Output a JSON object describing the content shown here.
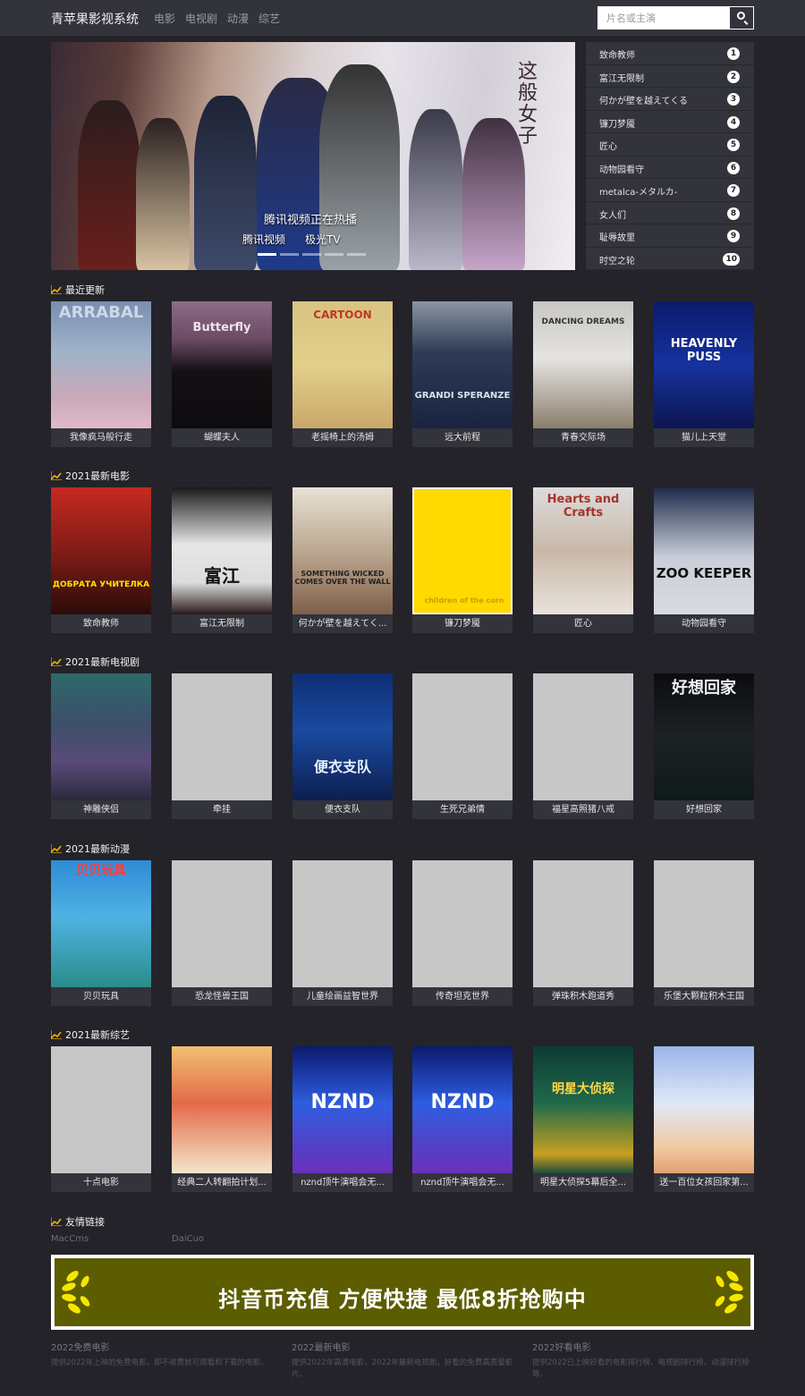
{
  "header": {
    "brand": "青苹果影视系统",
    "nav": [
      "电影",
      "电视剧",
      "动漫",
      "综艺"
    ],
    "search_placeholder": "片名或主演"
  },
  "banner": {
    "vertical_title": "这般女子",
    "caption": "腾讯视频正在热播",
    "logos": [
      "腾讯视频",
      "极光TV"
    ],
    "slide_count": 5,
    "active_slide": 1
  },
  "ranking": [
    {
      "name": "致命教师",
      "num": "1"
    },
    {
      "name": "富江无限制",
      "num": "2"
    },
    {
      "name": "何かが壁を越えてくる",
      "num": "3"
    },
    {
      "name": "镰刀梦魇",
      "num": "4"
    },
    {
      "name": "匠心",
      "num": "5"
    },
    {
      "name": "动物园看守",
      "num": "6"
    },
    {
      "name": "metalca-メタルカ-",
      "num": "7"
    },
    {
      "name": "女人们",
      "num": "8"
    },
    {
      "name": "耻辱故里",
      "num": "9"
    },
    {
      "name": "时空之轮",
      "num": "10"
    }
  ],
  "sections": [
    {
      "title": "最近更新",
      "items": [
        {
          "caption": "我像疯马般行走",
          "poster_text": "ARRABAL",
          "style": "arrabal"
        },
        {
          "caption": "蝴蝶夫人",
          "poster_text": "Butterfly",
          "style": "butterfly"
        },
        {
          "caption": "老摇椅上的汤姆",
          "poster_text": "CARTOON",
          "style": "cartoon"
        },
        {
          "caption": "远大前程",
          "poster_text": "GRANDI SPERANZE",
          "style": "grandi"
        },
        {
          "caption": "青春交际场",
          "poster_text": "DANCING DREAMS",
          "style": "dancing"
        },
        {
          "caption": "猫儿上天堂",
          "poster_text": "HEAVENLY PUSS",
          "style": "heavenly"
        }
      ]
    },
    {
      "title": "2021最新电影",
      "items": [
        {
          "caption": "致命教师",
          "poster_text": "ДОБРАТА УЧИТЕЛКА",
          "style": "uchitelka"
        },
        {
          "caption": "富江无限制",
          "poster_text": "富江",
          "style": "tomie"
        },
        {
          "caption": "何かが壁を越えてく...",
          "poster_text": "SOMETHING WICKED COMES OVER THE WALL",
          "style": "wall"
        },
        {
          "caption": "镰刀梦魇",
          "poster_text": "children of the corn",
          "style": "corn"
        },
        {
          "caption": "匠心",
          "poster_text": "Hearts and Crafts",
          "style": "hearts"
        },
        {
          "caption": "动物园看守",
          "poster_text": "ZOO KEEPER",
          "style": "zoo"
        }
      ]
    },
    {
      "title": "2021最新电视剧",
      "items": [
        {
          "caption": "神雕侠侣",
          "poster_text": "",
          "style": "shendiao"
        },
        {
          "caption": "牵挂",
          "poster_text": "",
          "style": "empty"
        },
        {
          "caption": "便衣支队",
          "poster_text": "便衣支队",
          "style": "bianyi"
        },
        {
          "caption": "生死兄弟情",
          "poster_text": "",
          "style": "empty"
        },
        {
          "caption": "福星高照猪八戒",
          "poster_text": "",
          "style": "empty"
        },
        {
          "caption": "好想回家",
          "poster_text": "好想回家",
          "style": "haoxiang"
        }
      ]
    },
    {
      "title": "2021最新动漫",
      "items": [
        {
          "caption": "贝贝玩具",
          "poster_text": "贝贝玩具",
          "style": "beibei"
        },
        {
          "caption": "恐龙怪兽王国",
          "poster_text": "",
          "style": "empty"
        },
        {
          "caption": "儿童绘画益智世界",
          "poster_text": "",
          "style": "empty"
        },
        {
          "caption": "传奇坦克世界",
          "poster_text": "",
          "style": "empty"
        },
        {
          "caption": "弹珠积木跑道秀",
          "poster_text": "",
          "style": "empty"
        },
        {
          "caption": "乐堡大颗粒积木王国",
          "poster_text": "",
          "style": "empty"
        }
      ]
    },
    {
      "title": "2021最新综艺",
      "items": [
        {
          "caption": "十点电影",
          "poster_text": "",
          "style": "empty"
        },
        {
          "caption": "经典二人转翻拍计划...",
          "poster_text": "",
          "style": "errenzhuan"
        },
        {
          "caption": "nznd顶牛演唱会无...",
          "poster_text": "NZND",
          "style": "nznd"
        },
        {
          "caption": "nznd顶牛演唱会无...",
          "poster_text": "NZND",
          "style": "nznd"
        },
        {
          "caption": "明星大侦探5幕后全...",
          "poster_text": "明星大侦探",
          "style": "mingxing"
        },
        {
          "caption": "送一百位女孩回家第...",
          "poster_text": "",
          "style": "songyibai"
        }
      ]
    }
  ],
  "friend_links": {
    "title": "友情链接",
    "items": [
      "MacCms",
      "DaiCuo"
    ]
  },
  "ad": {
    "text": "抖音币充值 方便快捷 最低8折抢购中"
  },
  "footer": [
    {
      "title": "2022免费电影",
      "desc": "提供2022年上映的免费电影，即不收费就可观看和下载的电影。"
    },
    {
      "title": "2022最新电影",
      "desc": "提供2022年高清电影，2022年最新电视剧，好看的免费高质量影片。"
    },
    {
      "title": "2022好看电影",
      "desc": "提供2022已上映好看的电影排行榜、电视剧排行榜，动漫排行榜等。"
    }
  ],
  "colors": {
    "page_bg": "#24232a",
    "panel_bg": "#32333b",
    "accent_icon": "#f0b400",
    "ad_bg": "#5c5c00"
  }
}
